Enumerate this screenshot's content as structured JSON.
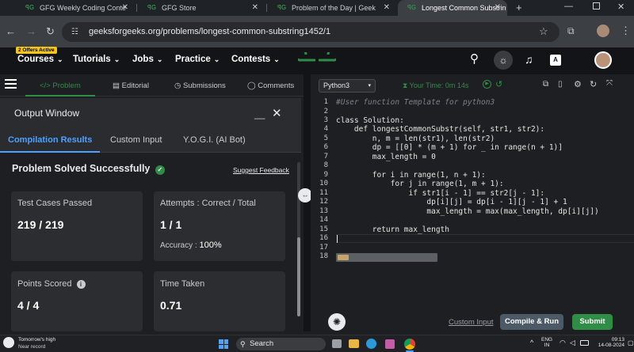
{
  "browser": {
    "tabs": [
      {
        "title": "GFG Weekly Coding Conte"
      },
      {
        "title": "GFG Store"
      },
      {
        "title": "Problem of the Day | Geek"
      },
      {
        "title": "Longest Common Substrin"
      }
    ],
    "new_tab": "+",
    "url": "geeksforgeeks.org/problems/longest-common-substring1452/1"
  },
  "header": {
    "offer_badge": "2 Offers Active",
    "menu": [
      {
        "label": "Courses"
      },
      {
        "label": "Tutorials"
      },
      {
        "label": "Jobs"
      },
      {
        "label": "Practice"
      },
      {
        "label": "Contests"
      }
    ],
    "logo": "GfG",
    "lang_badge": "A",
    "brand_color": "#2f8d46"
  },
  "subnav": {
    "tabs": [
      {
        "label": "Problem"
      },
      {
        "label": "Editorial"
      },
      {
        "label": "Submissions"
      },
      {
        "label": "Comments"
      }
    ]
  },
  "output": {
    "title": "Output Window",
    "tabs": [
      {
        "label": "Compilation Results"
      },
      {
        "label": "Custom Input"
      },
      {
        "label": "Y.O.G.I. (AI Bot)"
      }
    ],
    "status": "Problem Solved Successfully",
    "suggest_feedback": "Suggest Feedback",
    "cards": {
      "test_cases_label": "Test Cases Passed",
      "test_cases_value": "219 / 219",
      "attempts_label": "Attempts : Correct / Total",
      "attempts_value": "1 / 1",
      "accuracy_label": "Accuracy :",
      "accuracy_value": "100%",
      "points_label": "Points Scored",
      "points_value": "4 / 4",
      "time_label": "Time Taken",
      "time_value": "0.71"
    }
  },
  "editor": {
    "language": "Python3",
    "timer": "Your Time: 0m 14s",
    "lines": [
      {
        "n": "1",
        "text": "#User function Template for python3",
        "comment": true
      },
      {
        "n": "2",
        "text": ""
      },
      {
        "n": "3",
        "text": "class Solution:"
      },
      {
        "n": "4",
        "text": "    def longestCommonSubstr(self, str1, str2):"
      },
      {
        "n": "5",
        "text": "        n, m = len(str1), len(str2)"
      },
      {
        "n": "6",
        "text": "        dp = [[0] * (m + 1) for _ in range(n + 1)]"
      },
      {
        "n": "7",
        "text": "        max_length = 0"
      },
      {
        "n": "8",
        "text": ""
      },
      {
        "n": "9",
        "text": "        for i in range(1, n + 1):"
      },
      {
        "n": "10",
        "text": "            for j in range(1, m + 1):"
      },
      {
        "n": "11",
        "text": "                if str1[i - 1] == str2[j - 1]:"
      },
      {
        "n": "12",
        "text": "                    dp[i][j] = dp[i - 1][j - 1] + 1"
      },
      {
        "n": "13",
        "text": "                    max_length = max(max_length, dp[i][j])"
      },
      {
        "n": "14",
        "text": ""
      },
      {
        "n": "15",
        "text": "        return max_length"
      },
      {
        "n": "16",
        "text": ""
      },
      {
        "n": "17",
        "text": ""
      },
      {
        "n": "18",
        "text": ""
      }
    ],
    "custom_input": "Custom Input",
    "compile_run": "Compile & Run",
    "submit": "Submit",
    "submit_color": "#2f8d46",
    "compile_color": "#4b5a66"
  },
  "taskbar": {
    "weather_title": "Tomorrow's high",
    "weather_sub": "Near record",
    "search": "Search",
    "lang_top": "ENG",
    "lang_bottom": "IN",
    "time": "09:13",
    "date": "14-08-2024"
  }
}
